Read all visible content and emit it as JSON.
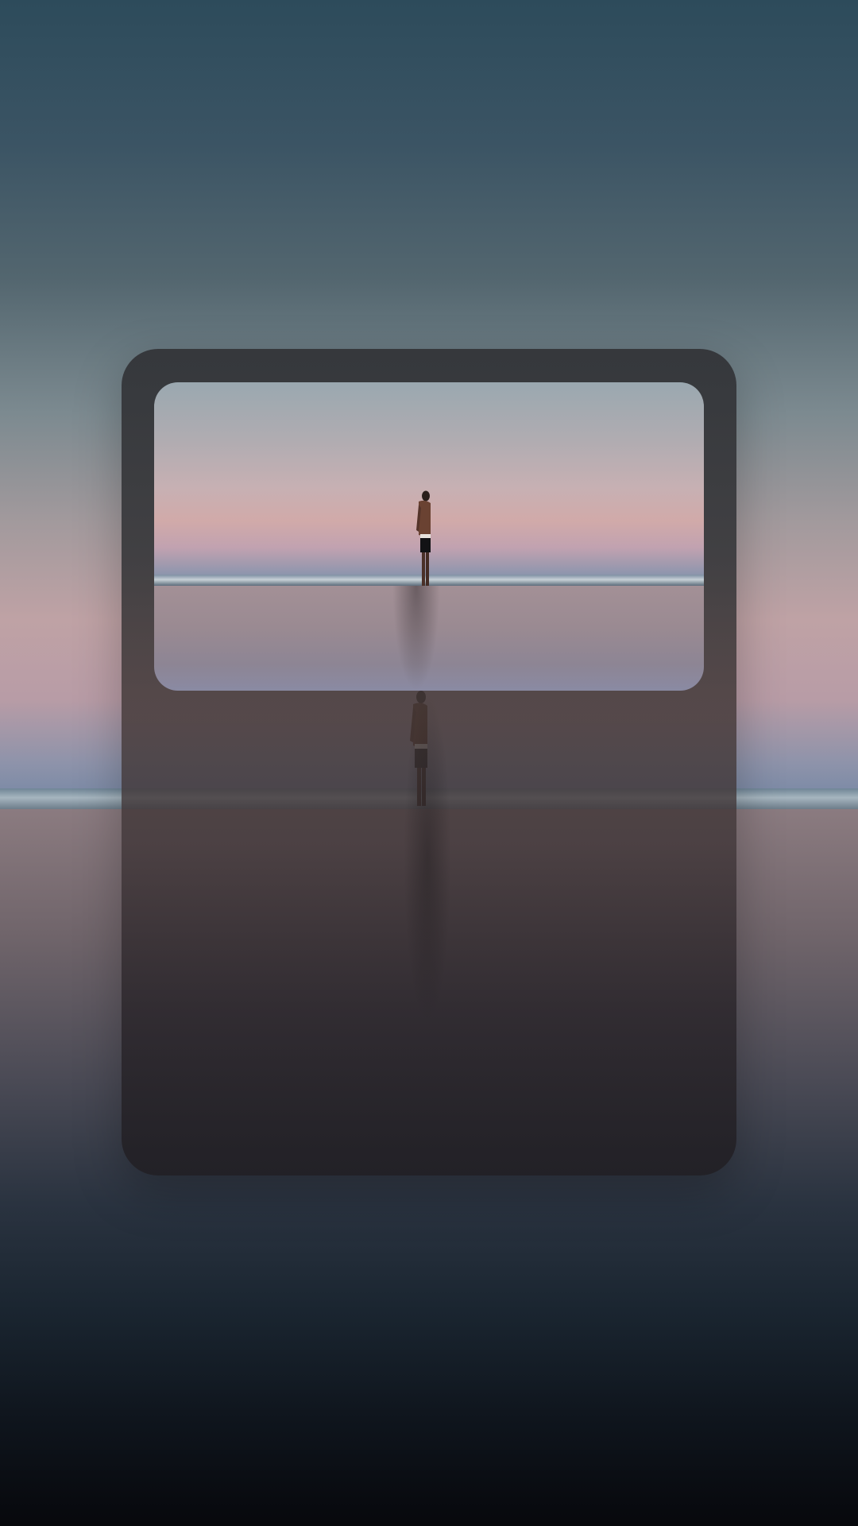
{
  "screen": {
    "type": "photo-widget-wallpaper"
  },
  "wallpaper": {
    "icon": "beach-sunset-person-looking-up",
    "colors": {
      "sky_top": "#2d4b5b",
      "sky_mid": "#7c8a90",
      "sky_low": "#bfa2a5",
      "sea_top": "#8b7b80",
      "sea_bottom": "#07080c"
    }
  },
  "widget": {
    "icon": "photo-frame-widget",
    "photo_icon": "person-standing-on-beach-at-dusk",
    "colors": {
      "card": "#363739",
      "photo_sky_top": "#9aa8b0",
      "photo_sky_bottom": "#d1aaa9",
      "photo_sea": "#9a8a92"
    }
  }
}
